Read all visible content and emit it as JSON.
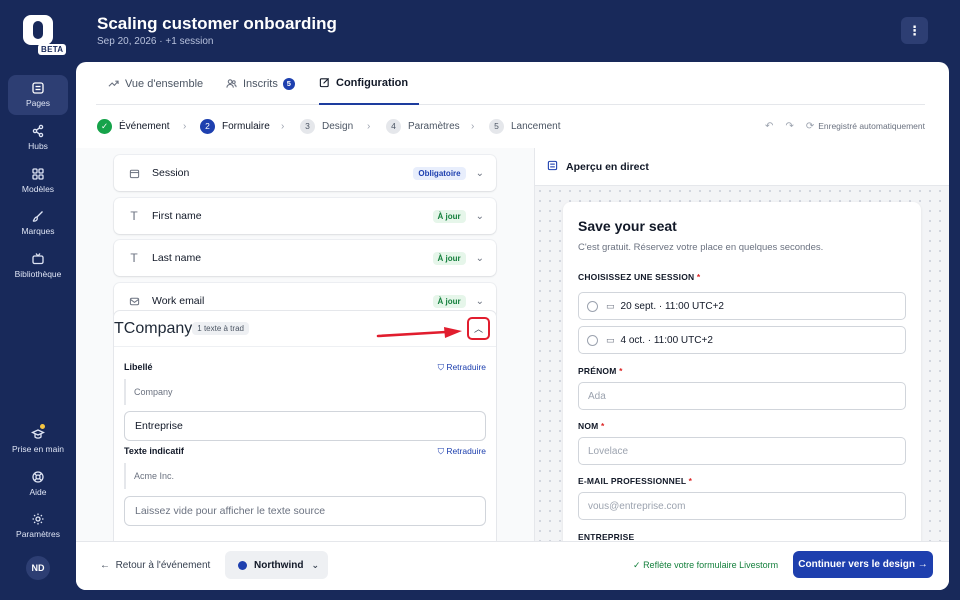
{
  "app": {
    "beta_label": "BETA",
    "title": "Scaling customer onboarding",
    "subtitle": "Sep 20, 2026 · +1 session",
    "more_label": "⋮"
  },
  "sidebar": {
    "top_items": [
      {
        "label": "Pages",
        "icon": "pages-icon",
        "active": true
      },
      {
        "label": "Hubs",
        "icon": "share-icon"
      },
      {
        "label": "Modèles",
        "icon": "grid-icon"
      },
      {
        "label": "Marques",
        "icon": "brush-icon"
      },
      {
        "label": "Bibliothèque",
        "icon": "tv-icon"
      }
    ],
    "bottom_items": [
      {
        "label": "Prise en main",
        "icon": "graduation-cap-icon"
      },
      {
        "label": "Aide",
        "icon": "help-icon"
      },
      {
        "label": "Paramètres",
        "icon": "gear-icon"
      }
    ],
    "avatar_initials": "ND"
  },
  "tabs": [
    {
      "label": "Vue d'ensemble",
      "icon": "trend-icon"
    },
    {
      "label": "Inscrits",
      "icon": "users-icon",
      "count": "5"
    },
    {
      "label": "Configuration",
      "icon": "edit-icon",
      "active": true
    }
  ],
  "steps": [
    {
      "num": "✓",
      "label": "Événement",
      "state": "done"
    },
    {
      "num": "2",
      "label": "Formulaire",
      "state": "current"
    },
    {
      "num": "3",
      "label": "Design",
      "state": "todo"
    },
    {
      "num": "4",
      "label": "Paramètres",
      "state": "todo"
    },
    {
      "num": "5",
      "label": "Lancement",
      "state": "todo"
    }
  ],
  "autosave_label": "Enregistré automatiquement",
  "fields": [
    {
      "name": "Session",
      "tag": "Obligatoire",
      "tag_type": "req",
      "icon": "calendar-icon"
    },
    {
      "name": "First name",
      "tag": "À jour",
      "tag_type": "ok",
      "icon": "text-icon"
    },
    {
      "name": "Last name",
      "tag": "À jour",
      "tag_type": "ok",
      "icon": "text-icon"
    },
    {
      "name": "Work email",
      "tag": "À jour",
      "tag_type": "ok",
      "icon": "mail-icon"
    }
  ],
  "expanded_field": {
    "name": "Company",
    "tag": "1 texte à trad",
    "label_heading": "Libellé",
    "retranslate": "Retraduire",
    "label_source": "Company",
    "label_value": "Entreprise",
    "placeholder_heading": "Texte indicatif",
    "placeholder_source": "Acme Inc.",
    "placeholder_value": "Laissez vide pour afficher le texte source"
  },
  "preview": {
    "heading": "Aperçu en direct",
    "form_title": "Save your seat",
    "form_subtitle": "C'est gratuit. Réservez votre place en quelques secondes.",
    "session_label": "CHOISISSEZ UNE SESSION",
    "sessions": [
      "20 sept. · 11:00 UTC+2",
      "4 oct. · 11:00 UTC+2"
    ],
    "first_label": "PRÉNOM",
    "first_placeholder": "Ada",
    "last_label": "NOM",
    "last_placeholder": "Lovelace",
    "email_label": "E-MAIL PROFESSIONNEL",
    "email_placeholder": "vous@entreprise.com",
    "company_label": "ENTREPRISE",
    "required_mark": "*"
  },
  "footer": {
    "back_label": "Retour à l'événement",
    "org_name": "Northwind",
    "reflect_label": "Reflète votre formulaire Livestorm",
    "cta_label": "Continuer vers le design →"
  },
  "colors": {
    "sidebar_bg": "#18295a",
    "accent": "#1e40af",
    "highlight": "#e11d2e"
  }
}
